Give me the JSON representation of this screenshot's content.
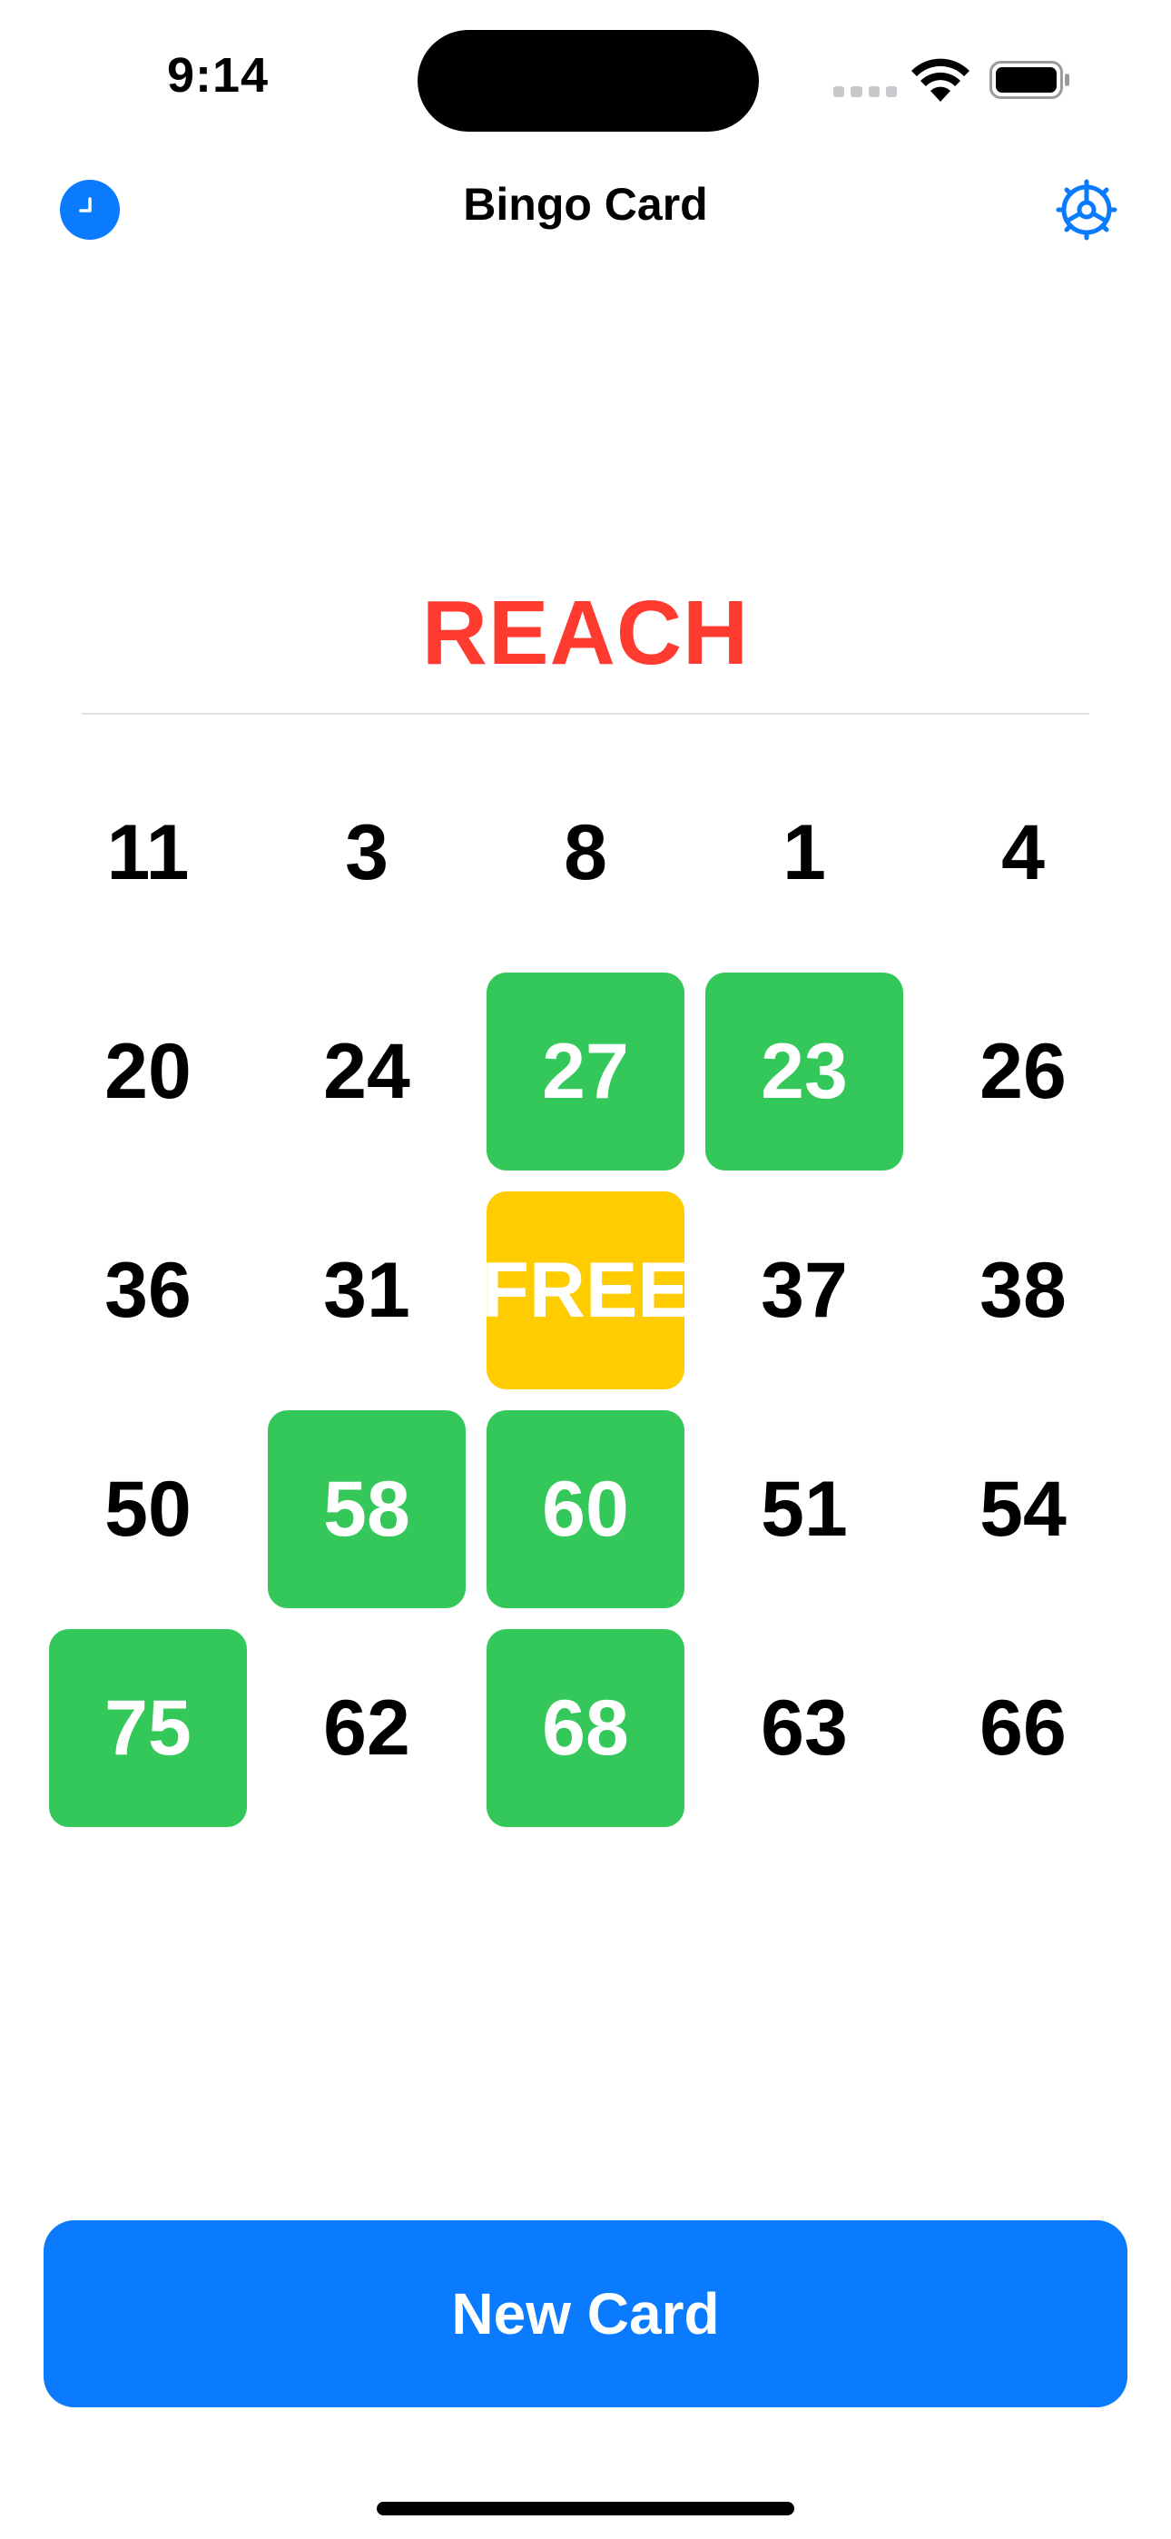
{
  "status_bar": {
    "time": "9:14"
  },
  "nav": {
    "title": "Bingo Card",
    "left_icon": "clock-icon",
    "right_icon": "gear-icon"
  },
  "game": {
    "status": "REACH",
    "free_label": "FREE"
  },
  "card": {
    "rows": [
      [
        {
          "label": "11",
          "state": "normal"
        },
        {
          "label": "3",
          "state": "normal"
        },
        {
          "label": "8",
          "state": "normal"
        },
        {
          "label": "1",
          "state": "normal"
        },
        {
          "label": "4",
          "state": "normal"
        }
      ],
      [
        {
          "label": "20",
          "state": "normal"
        },
        {
          "label": "24",
          "state": "normal"
        },
        {
          "label": "27",
          "state": "marked"
        },
        {
          "label": "23",
          "state": "marked"
        },
        {
          "label": "26",
          "state": "normal"
        }
      ],
      [
        {
          "label": "36",
          "state": "normal"
        },
        {
          "label": "31",
          "state": "normal"
        },
        {
          "label": "FREE",
          "state": "free"
        },
        {
          "label": "37",
          "state": "normal"
        },
        {
          "label": "38",
          "state": "normal"
        }
      ],
      [
        {
          "label": "50",
          "state": "normal"
        },
        {
          "label": "58",
          "state": "marked"
        },
        {
          "label": "60",
          "state": "marked"
        },
        {
          "label": "51",
          "state": "normal"
        },
        {
          "label": "54",
          "state": "normal"
        }
      ],
      [
        {
          "label": "75",
          "state": "marked"
        },
        {
          "label": "62",
          "state": "normal"
        },
        {
          "label": "68",
          "state": "marked"
        },
        {
          "label": "63",
          "state": "normal"
        },
        {
          "label": "66",
          "state": "normal"
        }
      ]
    ]
  },
  "actions": {
    "new_card_label": "New Card"
  },
  "colors": {
    "accent": "#0a7aff",
    "marked": "#34c759",
    "free": "#ffcc00",
    "reach": "#ff3b30"
  }
}
